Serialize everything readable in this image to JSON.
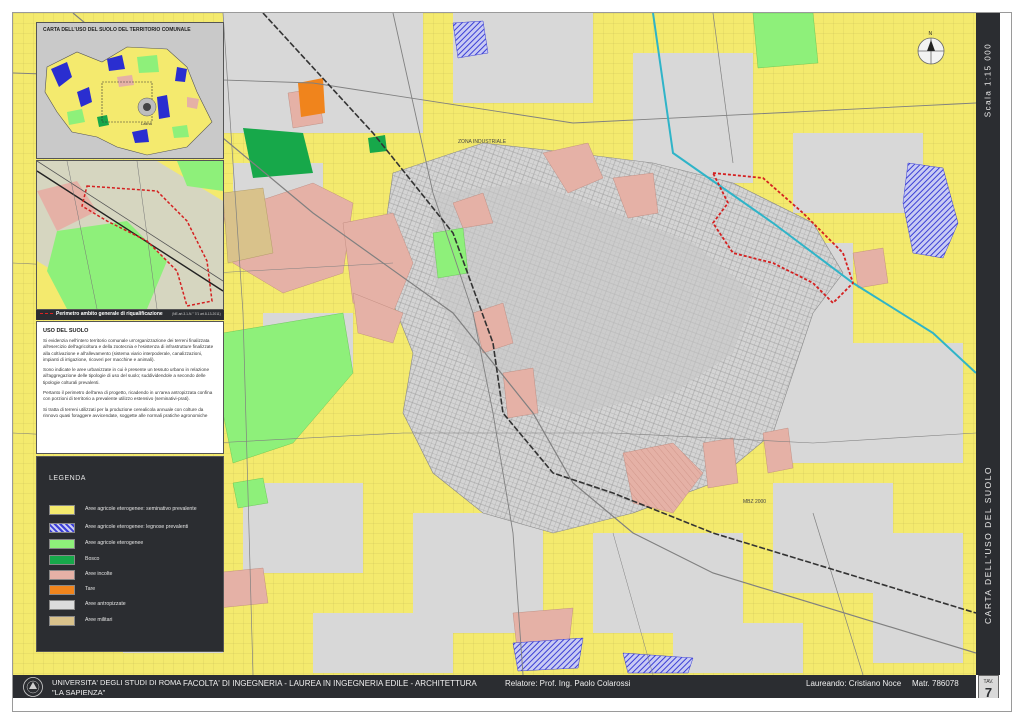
{
  "colors": {
    "seminativo": "#f4ea6e",
    "legnose": "#3b3fd6",
    "eterogenee": "#8ef07a",
    "bosco": "#17a84a",
    "incolte": "#e5b1a6",
    "tare": "#f0841c",
    "antropizzate": "#dcdcdc",
    "militari": "#d9c28b",
    "perimetro": "#d42020",
    "canal": "#2fb4c8"
  },
  "inset": {
    "title": "CARTA DELL'USO DEL SUOLO DEL TERRITORIO COMUNALE",
    "town_label": "Latina"
  },
  "perimeter_legend": {
    "label": "Perimetro ambito generale di riqualificazione",
    "note": "(NE.art.3.1-N.° 7/1 art.8-13-2011)"
  },
  "uso_suolo": {
    "heading": "USO DEL SUOLO",
    "paragraphs": [
      "Si evidenzia nell'intero territorio comunale un'organizzazione dei terreni finalizzata all'esercizio dell'agricoltura e della zootecnia e l'esistenza di infrastrutture finalizzate alla coltivazione e all'allevamento (sistema viario interpoderale, canalizzazioni, impianti di irrigazione, ricoveri per macchine e animali).",
      "Sono indicate le aree urbanizzate in cui è presente un tessuto urbano in relazione all'aggregazione delle tipologie di uso del suolo; suddividendole a secondo delle tipologie colturali prevalenti.",
      "Pertanto il perimetro dell'area di progetto, ricadendo in un'area antropizzata confina con porzioni di territorio a prevalente utilizzo estensivo (seminativi-prati).",
      "Si tratta di terreni utilizzati per la produzione cerealicola annuale con colture da rinnovo quasi foraggere avvicendate, soggette alle normali pratiche agronomiche"
    ]
  },
  "legend": {
    "title": "LEGENDA",
    "items": [
      {
        "label": "Aree agricole eterogenee: seminativo prevalente",
        "color": "#f4ea6e",
        "pattern": "solid"
      },
      {
        "label": "Aree agricole eterogenee: legnose prevalenti",
        "color": "#3b3fd6",
        "pattern": "hatch"
      },
      {
        "label": "Aree agricole eterogenee",
        "color": "#8ef07a",
        "pattern": "solid"
      },
      {
        "label": "Bosco",
        "color": "#17a84a",
        "pattern": "solid"
      },
      {
        "label": "Aree incolte",
        "color": "#e5b1a6",
        "pattern": "solid"
      },
      {
        "label": "Tare",
        "color": "#f0841c",
        "pattern": "solid"
      },
      {
        "label": "Aree antropizzate",
        "color": "#dcdcdc",
        "pattern": "solid"
      },
      {
        "label": "Aree militari",
        "color": "#d9c28b",
        "pattern": "solid"
      }
    ]
  },
  "map_labels": {
    "zone_a": "ZONA INDUSTRIALE",
    "zone_b": "MBZ 2000"
  },
  "side": {
    "scale": "Scala 1:15 000",
    "title": "CARTA DELL'USO DEL SUOLO",
    "tav": "TAV.",
    "tav_num": "7"
  },
  "footer": {
    "university_line1": "UNIVERSITA' DEGLI STUDI DI ROMA",
    "university_line2": "\"LA SAPIENZA\"",
    "faculty": "FACOLTA' DI INGEGNERIA  -  LAUREA IN INGEGNERIA EDILE - ARCHITETTURA",
    "relatore": "Relatore: Prof. Ing. Paolo Colarossi",
    "laureando": "Laureando: Cristiano Noce",
    "matr": "Matr. 786078"
  },
  "compass": {
    "north": "N"
  }
}
